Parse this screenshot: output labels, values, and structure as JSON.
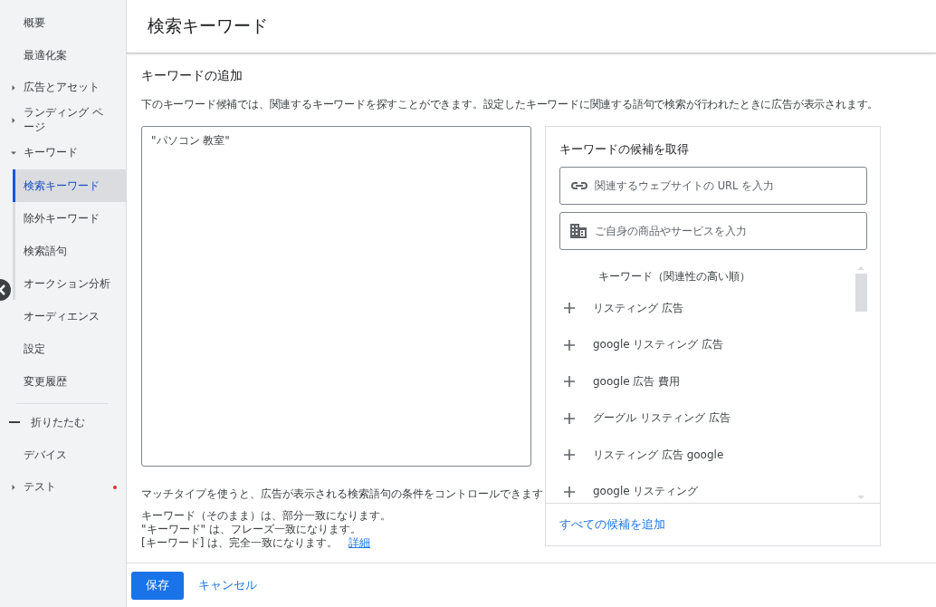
{
  "sidebar": {
    "items": [
      {
        "label": "概要",
        "kind": "link",
        "selected": false
      },
      {
        "label": "最適化案",
        "kind": "link",
        "selected": false
      },
      {
        "label": "広告とアセット",
        "kind": "group",
        "expanded": false,
        "selected": false
      },
      {
        "label": "ランディング ページ",
        "kind": "group",
        "expanded": false,
        "selected": false
      },
      {
        "label": "キーワード",
        "kind": "group",
        "expanded": true,
        "selected": false,
        "children": [
          {
            "label": "検索キーワード",
            "selected": true
          },
          {
            "label": "除外キーワード",
            "selected": false
          },
          {
            "label": "検索語句",
            "selected": false
          },
          {
            "label": "オークション分析",
            "selected": false
          }
        ]
      },
      {
        "label": "オーディエンス",
        "kind": "link",
        "selected": false
      },
      {
        "label": "設定",
        "kind": "link",
        "selected": false
      },
      {
        "label": "変更履歴",
        "kind": "link",
        "selected": false
      },
      {
        "label": "折りたたむ",
        "kind": "collapse",
        "selected": false
      },
      {
        "label": "デバイス",
        "kind": "link",
        "selected": false
      },
      {
        "label": "テスト",
        "kind": "group",
        "expanded": false,
        "selected": false,
        "alert": true
      }
    ]
  },
  "header": {
    "title": "検索キーワード"
  },
  "section": {
    "heading": "キーワードの追加",
    "description": "下のキーワード候補では、関連するキーワードを探すことができます。設定したキーワードに関連する語句で検索が行われたときに広告が表示されます。"
  },
  "keyword_input": {
    "value": "\"パソコン 教室\""
  },
  "match_help": {
    "intro": "マッチタイプを使うと、広告が表示される検索語句の条件をコントロールできます",
    "lines": [
      "キーワード（そのまま）は、部分一致になります。",
      "\"キーワード\" は、フレーズ一致になります。",
      "[キーワード] は、完全一致になります。"
    ],
    "link": "詳細"
  },
  "suggestions": {
    "title": "キーワードの候補を取得",
    "url_field": {
      "placeholder": "関連するウェブサイトの URL を入力"
    },
    "product_field": {
      "placeholder": "ご自身の商品やサービスを入力"
    },
    "list_header": "キーワード（関連性の高い順）",
    "keywords": [
      "リスティング 広告",
      "google リスティング 広告",
      "google 広告 費用",
      "グーグル リスティング 広告",
      "リスティング 広告 google",
      "google リスティング"
    ],
    "add_all": "すべての候補を追加"
  },
  "buttons": {
    "save": "保存",
    "cancel": "キャンセル"
  }
}
